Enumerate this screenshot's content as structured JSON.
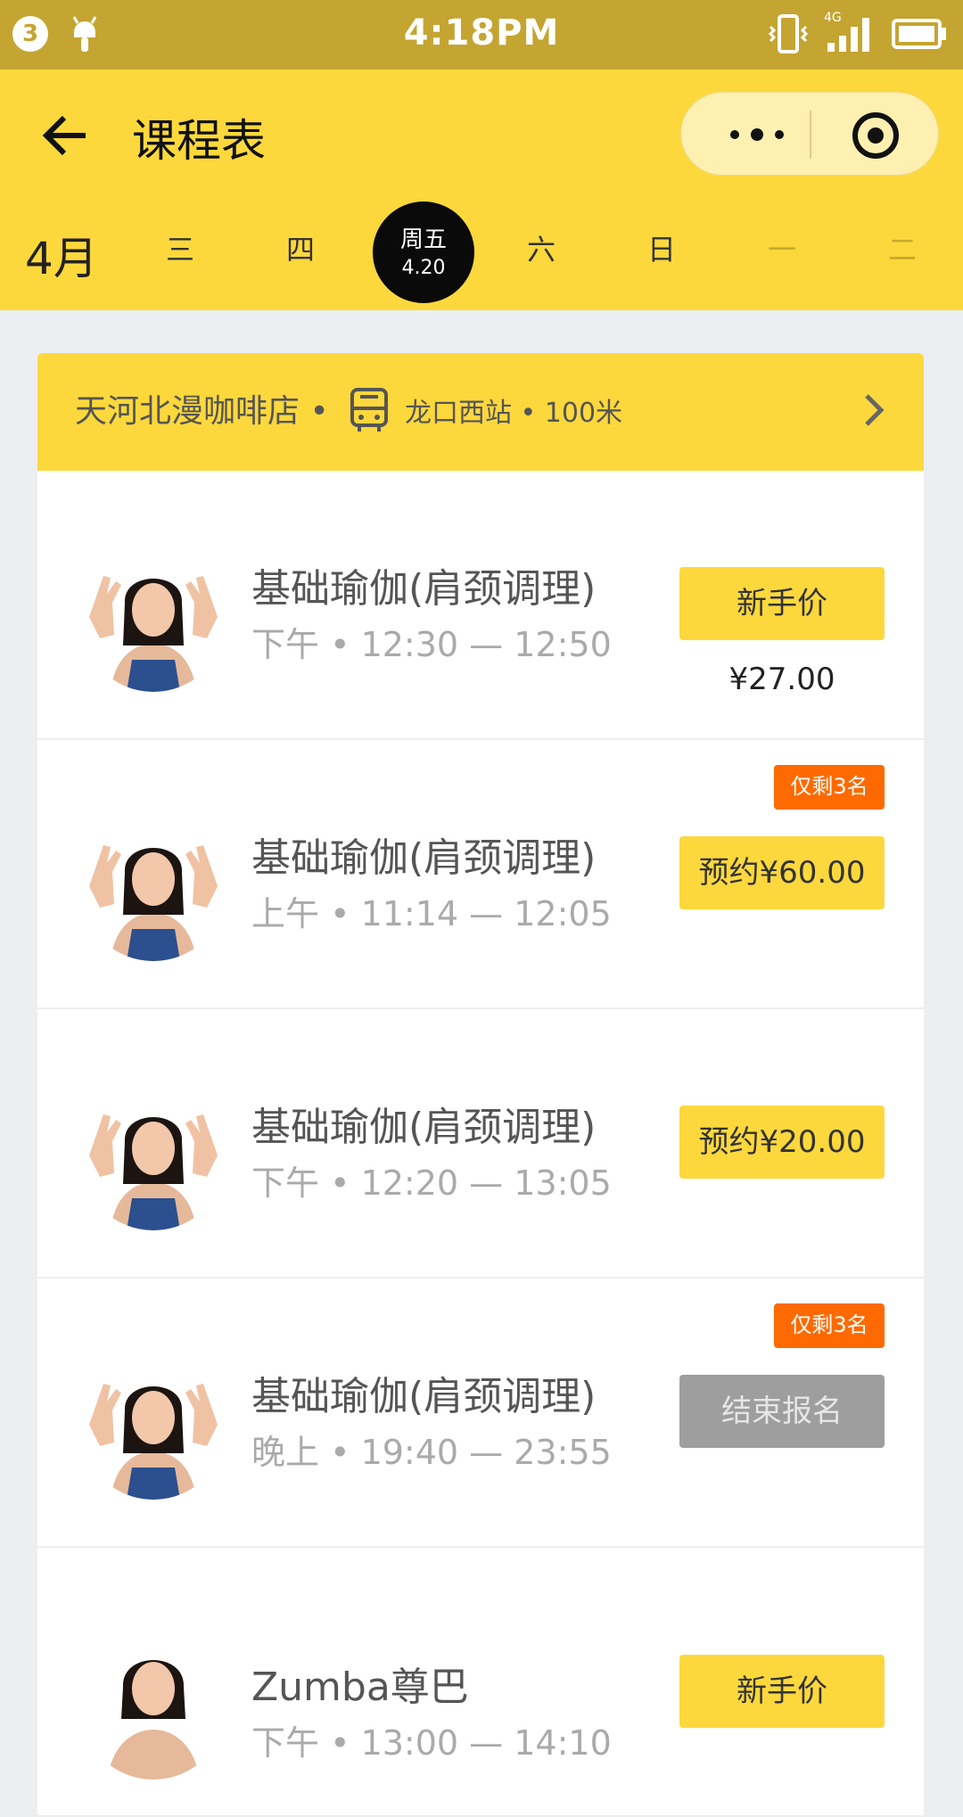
{
  "status_bar": {
    "notification_count": "3",
    "time": "4:18PM",
    "network": "4G"
  },
  "header": {
    "title": "课程表",
    "back_icon": "arrow-left-icon",
    "more_icon": "more-dots-icon",
    "close_icon": "target-circle-icon"
  },
  "calendar": {
    "month": "4月",
    "days": [
      "三",
      "四",
      "六",
      "日",
      "一",
      "二"
    ],
    "selected": {
      "weekday": "周五",
      "date": "4.20"
    }
  },
  "location": {
    "store": "天河北漫咖啡店 •",
    "station": "龙口西站 • 100米",
    "transit_icon": "bus-icon"
  },
  "courses": [
    {
      "name": "基础瑜伽(肩颈调理)",
      "time": "下午 • 12:30 — 12:50",
      "button": "新手价",
      "price": "¥27.00"
    },
    {
      "name": "基础瑜伽(肩颈调理)",
      "time": "上午 • 11:14 — 12:05",
      "button": "预约¥60.00",
      "tag": "仅剩3名"
    },
    {
      "name": "基础瑜伽(肩颈调理)",
      "time": "下午 • 12:20 — 13:05",
      "button": "预约¥20.00"
    },
    {
      "name": "基础瑜伽(肩颈调理)",
      "time": "晚上 • 19:40 — 23:55",
      "button": "结束报名",
      "tag": "仅剩3名"
    },
    {
      "name": "Zumba尊巴",
      "time": "下午 • 13:00 — 14:10",
      "button": "新手价"
    }
  ],
  "colors": {
    "accent": "#fdd83c",
    "status_bar": "#c4a531",
    "tag": "#fe6a00",
    "disabled": "#9e9e9e"
  }
}
